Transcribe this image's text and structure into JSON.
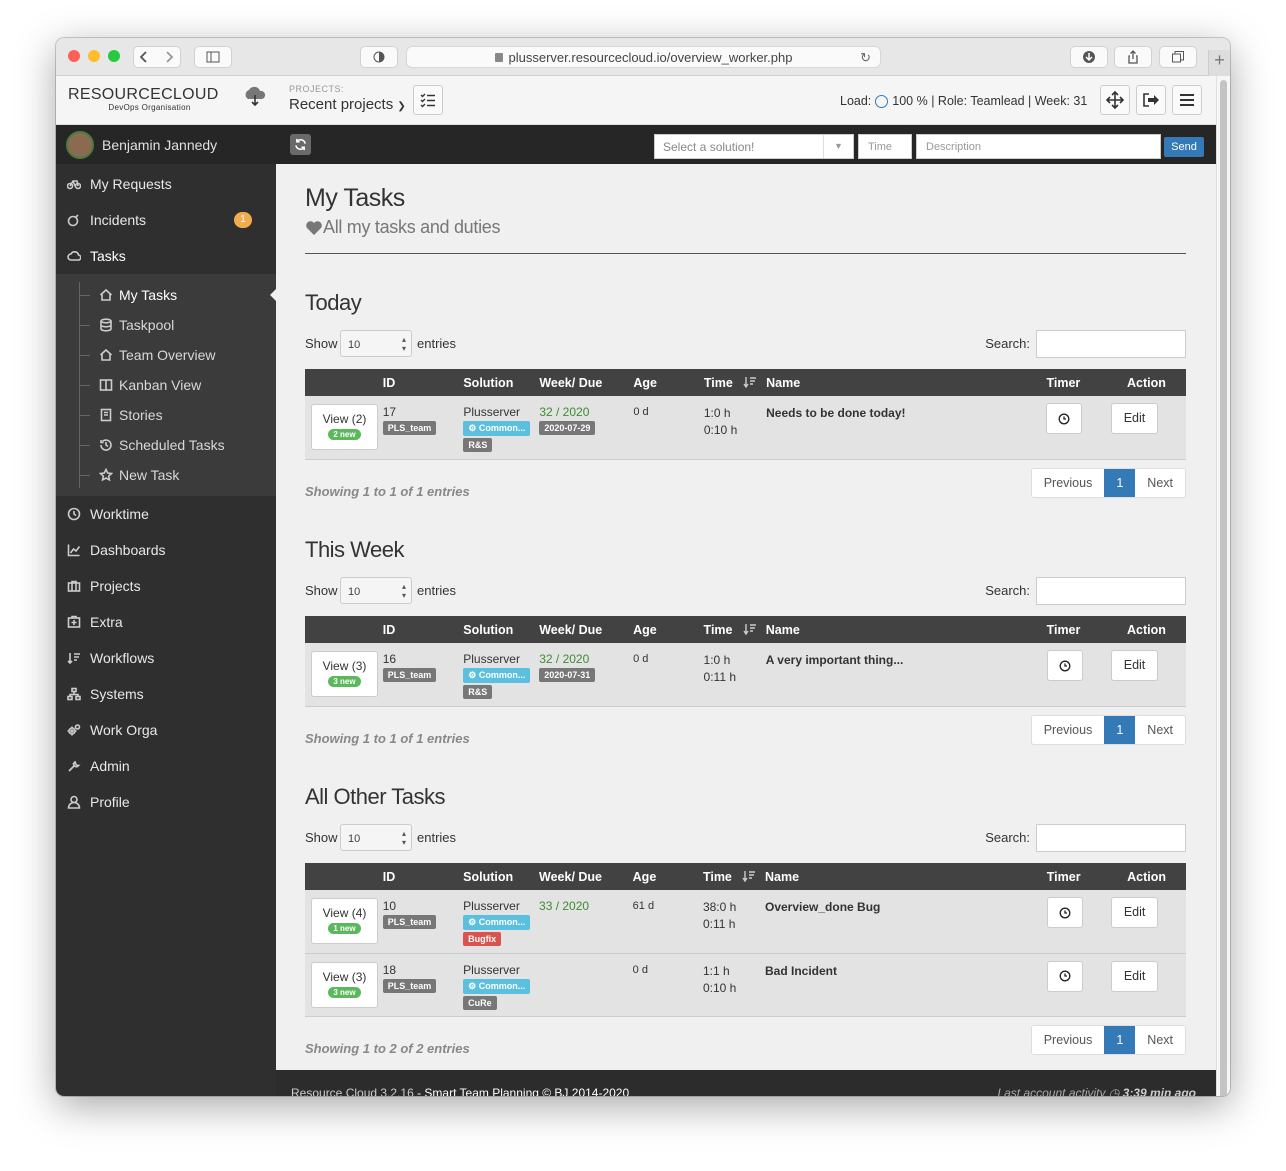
{
  "browser": {
    "url": "plusserver.resourcecloud.io/overview_worker.php"
  },
  "header": {
    "logo_main": "RESOURCECLOUD",
    "logo_sub": "DevOps Organisation",
    "projects_label": "PROJECTS:",
    "projects_value": "Recent projects",
    "load_label": "Load:",
    "load_value": "100 % | Role: Teamlead | Week: 31"
  },
  "topbar": {
    "solution_placeholder": "Select a solution!",
    "time_placeholder": "Time",
    "description_placeholder": "Description",
    "send_label": "Send"
  },
  "sidebar": {
    "user": "Benjamin Jannedy",
    "items": [
      {
        "label": "My Requests",
        "icon": "bicycle-icon"
      },
      {
        "label": "Incidents",
        "icon": "bomb-icon",
        "badge": "1"
      },
      {
        "label": "Tasks",
        "icon": "cloud-icon"
      }
    ],
    "subitems": [
      {
        "label": "My Tasks",
        "icon": "home-icon"
      },
      {
        "label": "Taskpool",
        "icon": "database-icon"
      },
      {
        "label": "Team Overview",
        "icon": "home-icon"
      },
      {
        "label": "Kanban View",
        "icon": "columns-icon"
      },
      {
        "label": "Stories",
        "icon": "book-icon"
      },
      {
        "label": "Scheduled Tasks",
        "icon": "history-icon"
      },
      {
        "label": "New Task",
        "icon": "star-icon"
      }
    ],
    "items2": [
      {
        "label": "Worktime",
        "icon": "clock-icon"
      },
      {
        "label": "Dashboards",
        "icon": "chart-icon"
      },
      {
        "label": "Projects",
        "icon": "briefcase-icon"
      },
      {
        "label": "Extra",
        "icon": "plus-box-icon"
      },
      {
        "label": "Workflows",
        "icon": "sort-icon"
      },
      {
        "label": "Systems",
        "icon": "sitemap-icon"
      },
      {
        "label": "Work Orga",
        "icon": "gears-icon"
      },
      {
        "label": "Admin",
        "icon": "wrench-icon"
      },
      {
        "label": "Profile",
        "icon": "user-icon"
      }
    ]
  },
  "page": {
    "title": "My Tasks",
    "subtitle": "All my tasks and duties"
  },
  "table_labels": {
    "show": "Show",
    "entries": "entries",
    "search": "Search:",
    "page_size": "10",
    "previous": "Previous",
    "next": "Next",
    "page": "1",
    "edit": "Edit"
  },
  "columns": [
    "ID",
    "Solution",
    "Week/ Due",
    "Age",
    "Time",
    "Name",
    "Timer",
    "Action"
  ],
  "sections": [
    {
      "title": "Today",
      "info": "Showing 1 to 1 of 1 entries",
      "rows": [
        {
          "view": "View (2)",
          "new": "2 new",
          "id": "17",
          "team": "PLS_team",
          "solution": "Plusserver",
          "common": "Common...",
          "tag": "R&S",
          "week": "32 / 2020",
          "due": "2020-07-29",
          "age": "0 d",
          "time1": "1:0 h",
          "time2": "0:10 h",
          "name": "Needs to be done today!"
        }
      ]
    },
    {
      "title": "This Week",
      "info": "Showing 1 to 1 of 1 entries",
      "rows": [
        {
          "view": "View (3)",
          "new": "3 new",
          "id": "16",
          "team": "PLS_team",
          "solution": "Plusserver",
          "common": "Common...",
          "tag": "R&S",
          "week": "32 / 2020",
          "due": "2020-07-31",
          "age": "0 d",
          "time1": "1:0 h",
          "time2": "0:11 h",
          "name": "A very important thing..."
        }
      ]
    },
    {
      "title": "All Other Tasks",
      "info": "Showing 1 to 2 of 2 entries",
      "rows": [
        {
          "view": "View (4)",
          "new": "1 new",
          "id": "10",
          "team": "PLS_team",
          "solution": "Plusserver",
          "common": "Common...",
          "tag": "Bugfix",
          "week": "33 / 2020",
          "due": "",
          "age": "61 d",
          "time1": "38:0 h",
          "time2": "0:11 h",
          "name": "Overview_done Bug"
        },
        {
          "view": "View (3)",
          "new": "3 new",
          "id": "18",
          "team": "PLS_team",
          "solution": "Plusserver",
          "common": "Common...",
          "tag": "CuRe",
          "week": "",
          "due": "",
          "age": "0 d",
          "time1": "1:1 h",
          "time2": "0:10 h",
          "name": "Bad Incident"
        }
      ]
    }
  ],
  "footer": {
    "version": "Resource Cloud 3.2.16",
    "text": " - Smart Team Planning © BJ 2014-2020",
    "activity_label": "Last account activity",
    "activity_value": "3:39 min ago"
  },
  "colors": {
    "accent": "#337ab7",
    "sidebar": "#2f2f2f",
    "badge": "#f0ad4e",
    "new_badge": "#5cb85c",
    "info_label": "#5bc0de",
    "danger_label": "#d9534f"
  }
}
